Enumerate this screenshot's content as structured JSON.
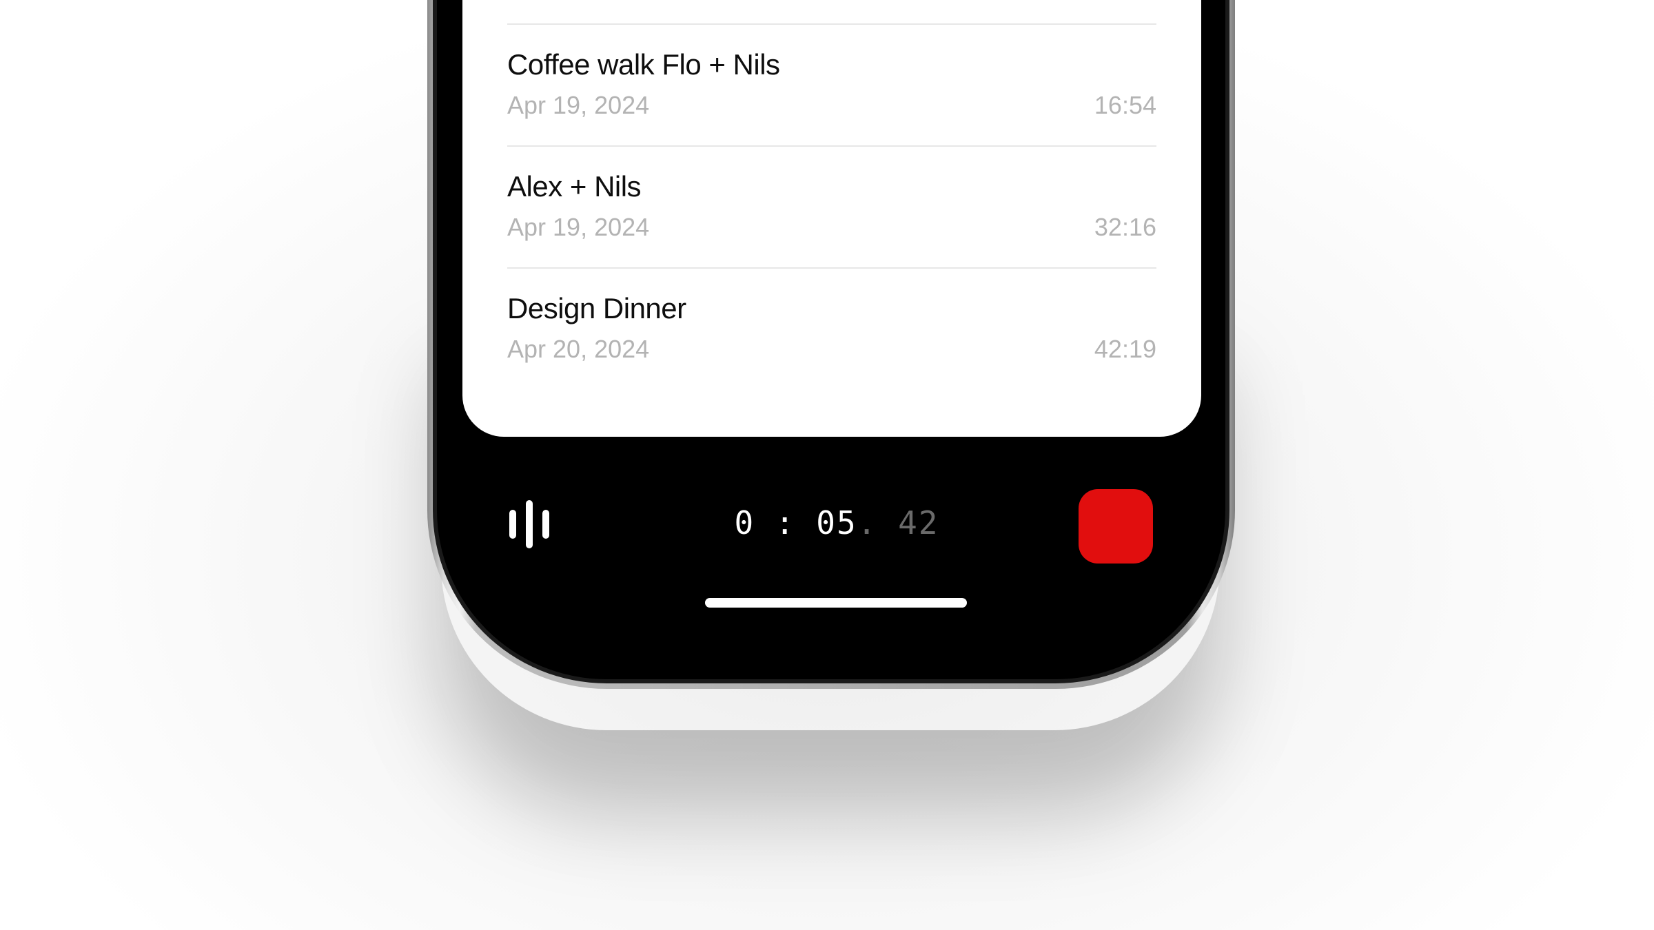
{
  "recordings": [
    {
      "title": "Coffee walk Flo + Nils",
      "date": "Apr 19, 2024",
      "duration": "16:54"
    },
    {
      "title": "Alex + Nils",
      "date": "Apr 19, 2024",
      "duration": "32:16"
    },
    {
      "title": "Design Dinner",
      "date": "Apr 20, 2024",
      "duration": "42:19"
    }
  ],
  "recorder": {
    "timer_main": "0 : 05",
    "timer_fraction": ". 42",
    "waveform_icon": "waveform-icon",
    "stop_icon": "stop-icon"
  },
  "colors": {
    "record_red": "#e10e0e",
    "secondary_text": "#b3b3b3",
    "screen_background": "#000000"
  }
}
